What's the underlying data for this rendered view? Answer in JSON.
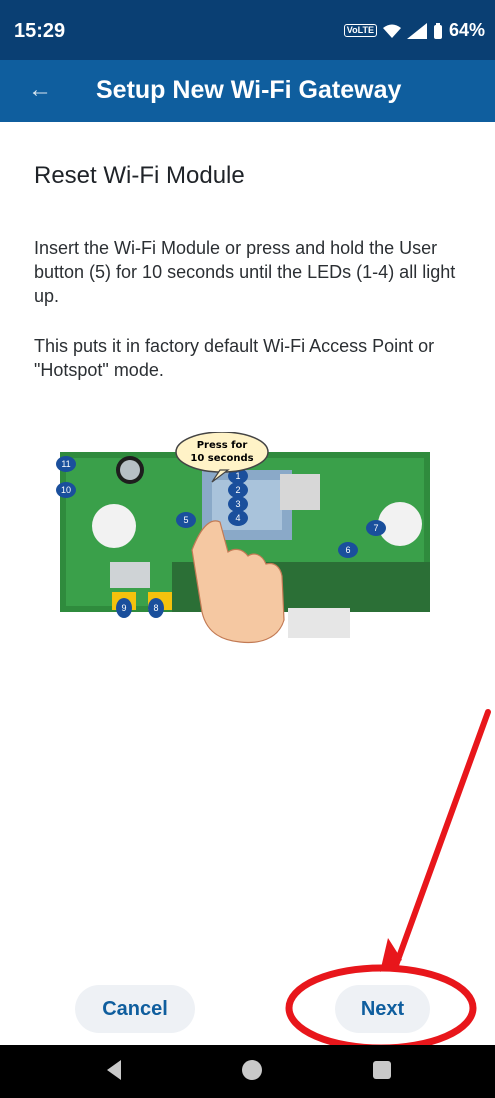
{
  "status": {
    "time": "15:29",
    "battery": "64%",
    "volte": "VoLTE"
  },
  "appbar": {
    "title": "Setup New Wi-Fi Gateway",
    "back_icon": "arrow-left-icon"
  },
  "content": {
    "heading": "Reset Wi-Fi Module",
    "paragraph1": "Insert the Wi-Fi Module or press and hold the User button (5) for 10 seconds until the LEDs (1-4) all light up.",
    "paragraph2": "This puts it in factory default Wi-Fi Access Point or \"Hotspot\" mode.",
    "image": {
      "speech_bubble_line1": "Press for",
      "speech_bubble_line2": "10 seconds",
      "labels": [
        "11",
        "10",
        "1",
        "2",
        "3",
        "4",
        "5",
        "6",
        "7",
        "9",
        "8"
      ]
    }
  },
  "buttons": {
    "cancel": "Cancel",
    "next": "Next"
  },
  "colors": {
    "statusbar": "#0a3f73",
    "appbar": "#0f5e9e",
    "accent": "#0f5e9e",
    "annotation": "#e8161b"
  }
}
